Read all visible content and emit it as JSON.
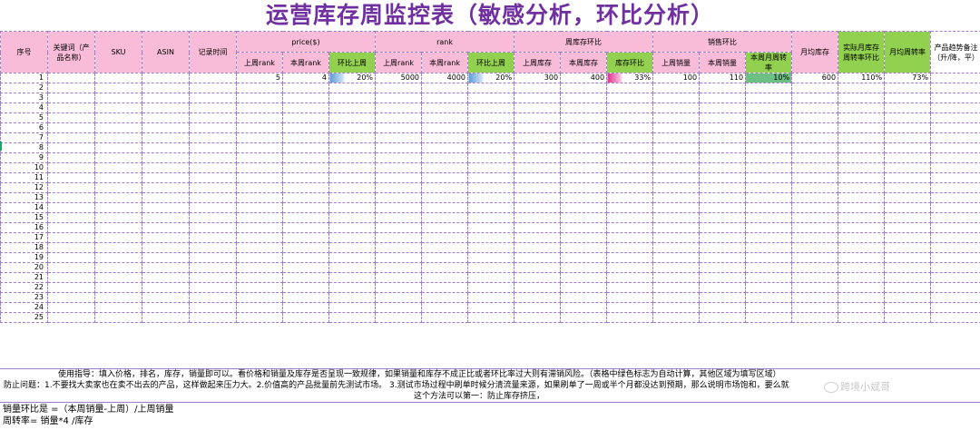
{
  "title": "运营库存周监控表（敏感分析，环比分析）",
  "headers": {
    "seq": "序号",
    "keyword": "关键词（产品名称）",
    "sku": "SKU",
    "asin": "ASIN",
    "record_time": "记录时间",
    "price_group": "price($)",
    "rank_group": "rank",
    "stock_group": "周库存环比",
    "sales_group": "销售环比",
    "monthly_stock": "月均库存",
    "actual_monthly_turnover": "实际月库存周转率环比",
    "monthly_weekly_turnover": "月均周转率",
    "trend_note": "产品趋势备注（升/降，平）",
    "price_last": "上周rank",
    "price_this": "本周rank",
    "price_mom": "环比上周",
    "rank_last": "上周rank",
    "rank_this": "本周rank",
    "rank_mom": "环比上周",
    "stock_last": "上周库存",
    "stock_this": "本周库存",
    "stock_mom": "库存环比",
    "sales_last": "上周销量",
    "sales_this": "本周销量",
    "turnover_this": "本周月周转率"
  },
  "row1": {
    "seq": "1",
    "price_last": "5",
    "price_this": "4",
    "price_mom": "20%",
    "rank_last": "5000",
    "rank_this": "4000",
    "rank_mom": "20%",
    "stock_last": "300",
    "stock_this": "400",
    "stock_mom": "33%",
    "sales_last": "100",
    "sales_this": "110",
    "turnover_this": "10%",
    "monthly_stock": "600",
    "actual_monthly_turnover": "110%",
    "monthly_weekly_turnover": "73%"
  },
  "row_numbers": [
    "2",
    "3",
    "4",
    "5",
    "6",
    "7",
    "8",
    "9",
    "10",
    "11",
    "12",
    "13",
    "14",
    "15",
    "16",
    "17",
    "18",
    "19",
    "20",
    "21",
    "22",
    "23",
    "24",
    "25"
  ],
  "notes": {
    "line1": "使用指导：填入价格，排名，库存，销量即可以。看价格和销量及库存是否呈现一致规律，如果销量和库存不成正比或者环比率过大则有滞销风险。（表格中绿色标志为自动计算，其他区域为填写区域）",
    "line2": "防止问题：1.不要找大卖家也在卖不出去的产品，这样做起来压力大。2.价值高的产品批量前先测试市场。  3.测试市场过程中刷单时候分清流量来源，如果刷单了一周或半个月都没达到预期，那么说明市场饱和，要么就",
    "line3": "这个方法可以第一：防止库存挤压，"
  },
  "formulas": {
    "sales_mom": "销量环比是 =（本周销量-上周）/上周销量",
    "turnover": "周转率= 销量*4 /库存"
  },
  "watermark": "跨境小斌哥"
}
